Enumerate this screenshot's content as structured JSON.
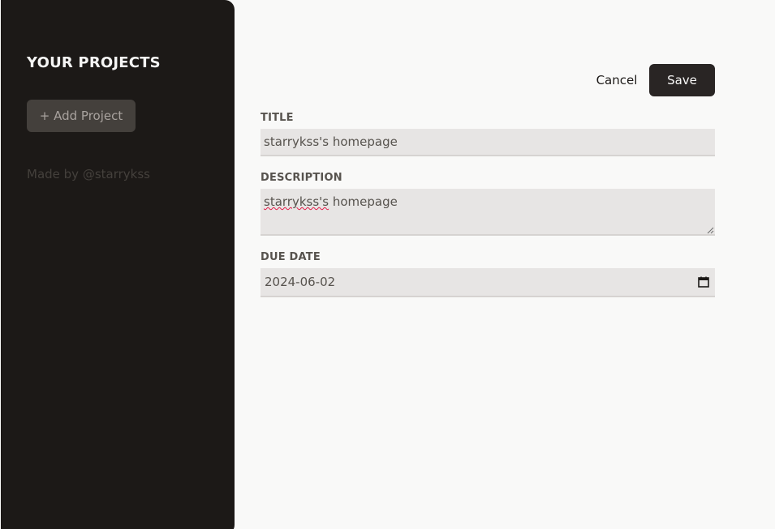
{
  "sidebar": {
    "title": "YOUR PROJECTS",
    "add_project_label": "+ Add Project",
    "credit": "Made by @starrykss"
  },
  "toolbar": {
    "cancel_label": "Cancel",
    "save_label": "Save"
  },
  "form": {
    "title": {
      "label": "TITLE",
      "value": "starrykss's homepage"
    },
    "description": {
      "label": "DESCRIPTION",
      "misspelled_word": "starrykss's",
      "rest": " homepage"
    },
    "due_date": {
      "label": "DUE DATE",
      "value": "2024-06-02"
    }
  },
  "icons": {
    "calendar": "calendar-icon",
    "resize": "resize-handle-icon"
  },
  "colors": {
    "sidebar_bg": "#1c1917",
    "primary_button": "#292524",
    "field_bg": "#e7e5e4",
    "spellcheck": "#e11d48"
  }
}
